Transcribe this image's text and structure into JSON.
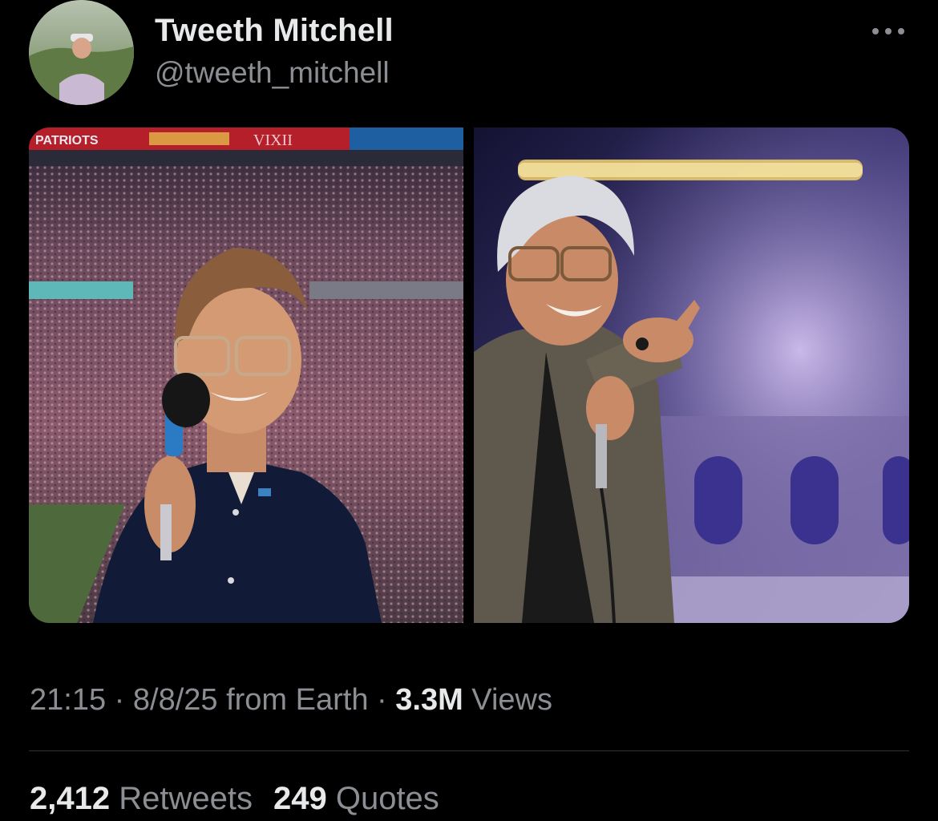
{
  "author": {
    "name": "Tweeth Mitchell",
    "handle": "@tweeth_mitchell"
  },
  "media": {
    "photos": [
      {
        "name": "photo-stadium-speaker",
        "scoreboard_text": "PATRIOTS",
        "banner_text": "VIXII"
      },
      {
        "name": "photo-stage-performer"
      }
    ]
  },
  "meta": {
    "time": "21:15",
    "separator": " · ",
    "date": "8/8/25",
    "source": " from Earth",
    "views_count": "3.3M",
    "views_label": " Views"
  },
  "stats": {
    "retweets_count": "2,412",
    "retweets_label": " Retweets",
    "quotes_count": "249",
    "quotes_label": " Quotes"
  },
  "colors": {
    "background": "#000000",
    "text_primary": "#e7e9ea",
    "text_secondary": "#8b8f94",
    "divider": "#2f3336"
  },
  "icons": {
    "more": "more-horizontal-icon"
  }
}
